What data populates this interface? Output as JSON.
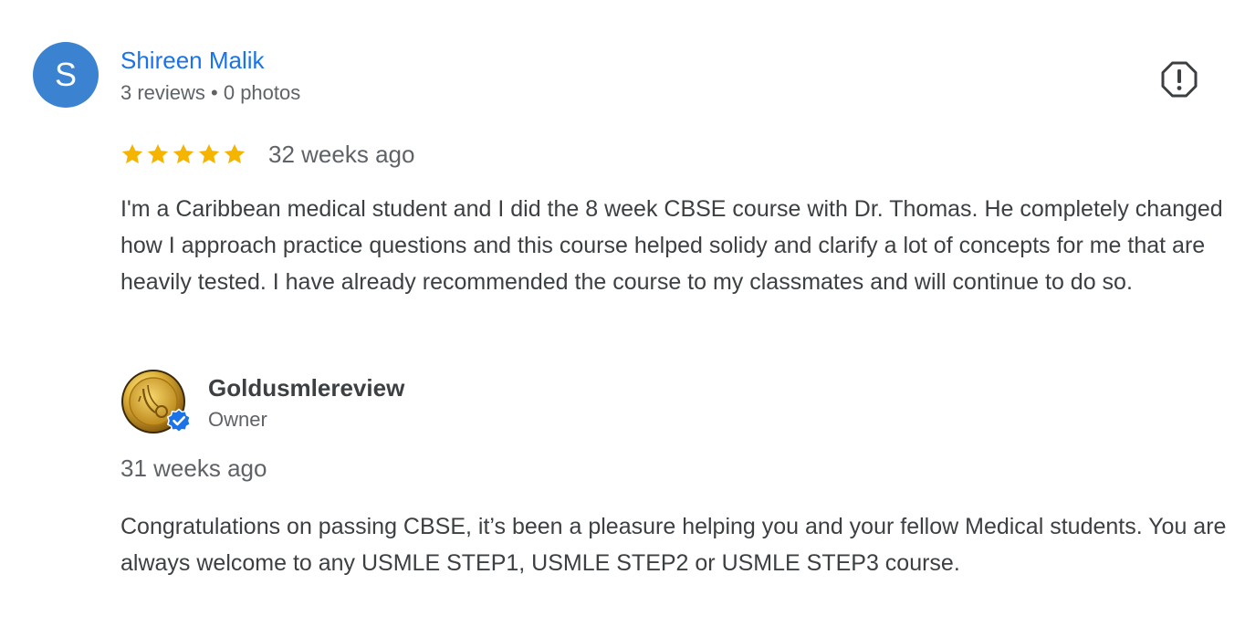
{
  "review": {
    "avatar_letter": "S",
    "avatar_color": "#3b82d0",
    "reviewer_name": "Shireen Malik",
    "reviewer_meta": "3 reviews • 0 photos",
    "flag_icon": "report-flag-icon",
    "rating": 5,
    "rating_max": 5,
    "star_color": "#f4b400",
    "date": "32 weeks ago",
    "text": "I'm a Caribbean medical student and I did the 8 week CBSE course with Dr. Thomas. He completely changed how I approach practice questions and this course helped solidy and clarify a lot of concepts for me that are heavily tested. I have already recommended the course to my classmates and will continue to do so."
  },
  "owner_reply": {
    "owner_name": "Goldusmlereview",
    "owner_role": "Owner",
    "avatar_icon": "gold-medal-logo-icon",
    "badge_icon": "verified-check-icon",
    "badge_color": "#1a73e8",
    "date": "31 weeks ago",
    "text": "Congratulations on passing CBSE, it’s been a pleasure helping you and your fellow Medical students. You are always welcome to any USMLE STEP1, USMLE STEP2 or USMLE STEP3 course."
  },
  "colors": {
    "link_blue": "#1a73e8",
    "text_primary": "#3c4043",
    "text_secondary": "#5f6368"
  }
}
